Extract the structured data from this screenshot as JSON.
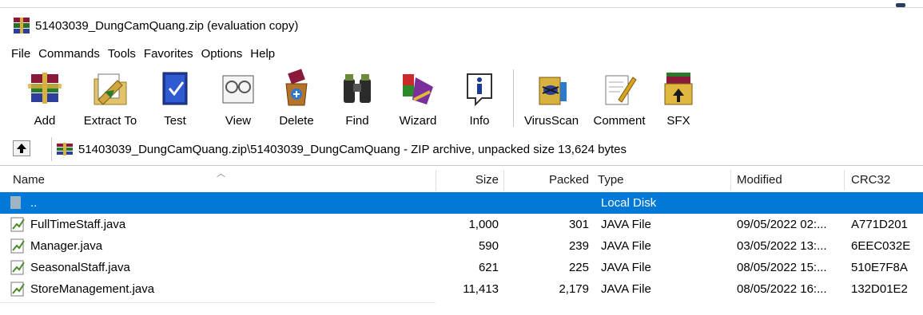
{
  "window": {
    "title": "51403039_DungCamQuang.zip (evaluation copy)"
  },
  "menu": [
    "File",
    "Commands",
    "Tools",
    "Favorites",
    "Options",
    "Help"
  ],
  "toolbar": {
    "add": "Add",
    "extract_to": "Extract To",
    "test": "Test",
    "view": "View",
    "delete": "Delete",
    "find": "Find",
    "wizard": "Wizard",
    "info": "Info",
    "virusscan": "VirusScan",
    "comment": "Comment",
    "sfx": "SFX"
  },
  "address": {
    "path": "51403039_DungCamQuang.zip\\51403039_DungCamQuang - ZIP archive, unpacked size 13,624 bytes"
  },
  "columns": {
    "name": "Name",
    "size": "Size",
    "packed": "Packed",
    "type": "Type",
    "modified": "Modified",
    "crc32": "CRC32"
  },
  "parent_row": {
    "name": "..",
    "type": "Local Disk"
  },
  "files": [
    {
      "name": "FullTimeStaff.java",
      "size": "1,000",
      "packed": "301",
      "type": "JAVA File",
      "modified": "09/05/2022 02:...",
      "crc32": "A771D201"
    },
    {
      "name": "Manager.java",
      "size": "590",
      "packed": "239",
      "type": "JAVA File",
      "modified": "03/05/2022 13:...",
      "crc32": "6EEC032E"
    },
    {
      "name": "SeasonalStaff.java",
      "size": "621",
      "packed": "225",
      "type": "JAVA File",
      "modified": "08/05/2022 15:...",
      "crc32": "510E7F8A"
    },
    {
      "name": "StoreManagement.java",
      "size": "11,413",
      "packed": "2,179",
      "type": "JAVA File",
      "modified": "08/05/2022 16:...",
      "crc32": "132D01E2"
    }
  ],
  "colors": {
    "selection": "#0078d7",
    "selection_text": "#ffffff"
  }
}
